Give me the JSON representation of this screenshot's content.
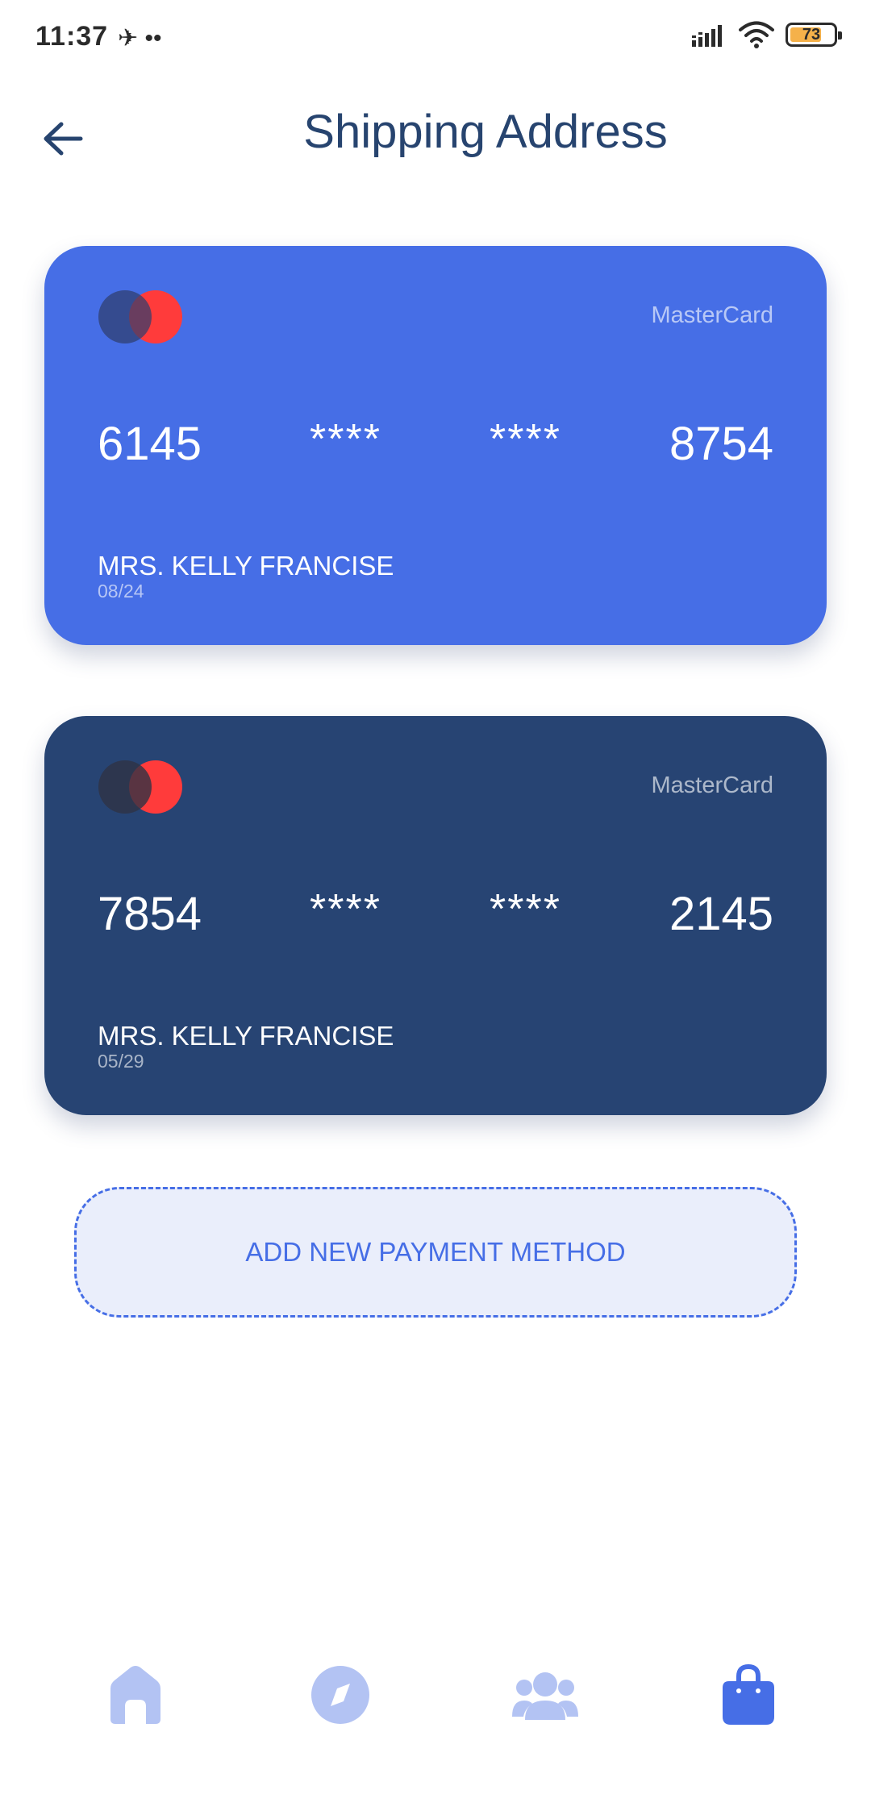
{
  "status_bar": {
    "time": "11:37",
    "left_icons": "✈ ••",
    "battery_level": 73,
    "battery_text": "73"
  },
  "header": {
    "title": "Shipping Address"
  },
  "cards": [
    {
      "brand": "MasterCard",
      "number_first": "6145",
      "mask_1": "****",
      "mask_2": "****",
      "number_last": "8754",
      "holder": "MRS. KELLY FRANCISE",
      "expiry": "08/24",
      "color": "#466ee6"
    },
    {
      "brand": "MasterCard",
      "number_first": "7854",
      "mask_1": "****",
      "mask_2": "****",
      "number_last": "2145",
      "holder": "MRS. KELLY FRANCISE",
      "expiry": "05/29",
      "color": "#274473"
    }
  ],
  "add_payment": {
    "label": "ADD NEW PAYMENT METHOD"
  },
  "bottom_nav": {
    "items": [
      {
        "icon": "home-icon",
        "active": false
      },
      {
        "icon": "compass-icon",
        "active": false
      },
      {
        "icon": "users-icon",
        "active": false
      },
      {
        "icon": "shopping-bag-icon",
        "active": true
      }
    ],
    "active_color": "#466ee6",
    "inactive_color": "#b3c3f3"
  }
}
